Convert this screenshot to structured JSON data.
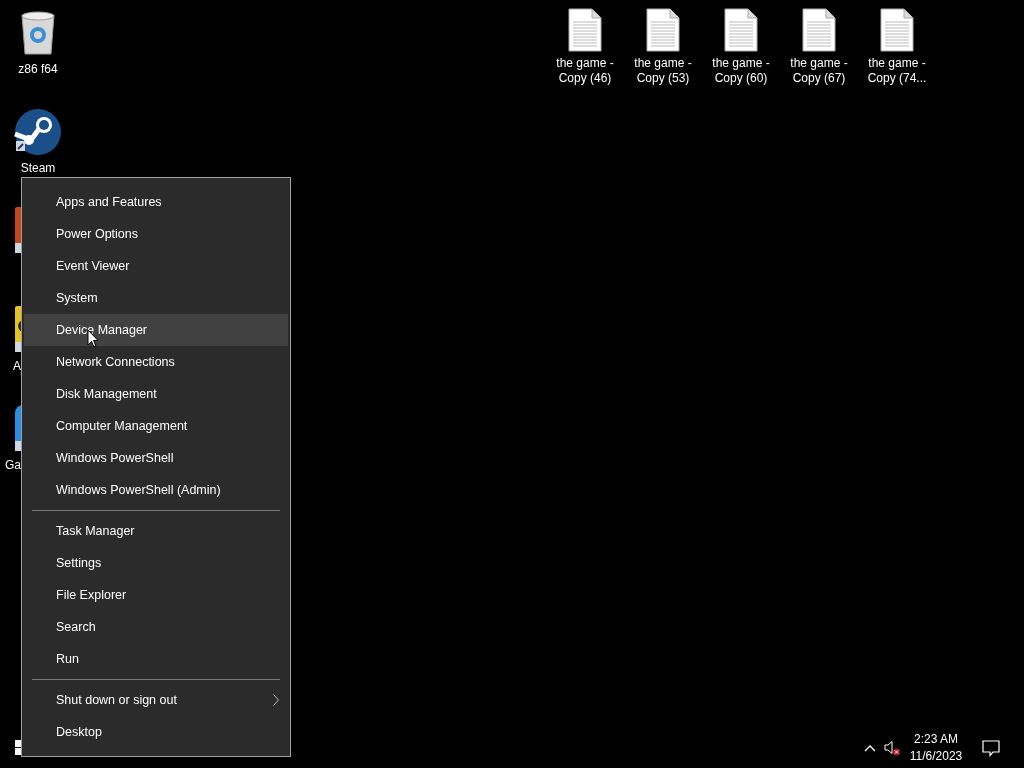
{
  "desktop_icons": [
    {
      "label": "z86 f64",
      "kind": "recycle-bin"
    },
    {
      "label": "Steam",
      "kind": "steam"
    },
    {
      "kind": "orange-app"
    },
    {
      "label": "A",
      "kind": "yellow-app"
    },
    {
      "label": "Ga",
      "kind": "blue-app"
    }
  ],
  "files": [
    {
      "label": "the game - Copy (46)"
    },
    {
      "label": "the game - Copy (53)"
    },
    {
      "label": "the game - Copy (60)"
    },
    {
      "label": "the game - Copy (67)"
    },
    {
      "label": "the game - Copy (74..."
    }
  ],
  "context_menu": {
    "groups": [
      [
        {
          "label": "Apps and Features",
          "selected": false,
          "submenu": false
        },
        {
          "label": "Power Options",
          "selected": false,
          "submenu": false
        },
        {
          "label": "Event Viewer",
          "selected": false,
          "submenu": false
        },
        {
          "label": "System",
          "selected": false,
          "submenu": false
        },
        {
          "label": "Device Manager",
          "selected": true,
          "submenu": false
        },
        {
          "label": "Network Connections",
          "selected": false,
          "submenu": false
        },
        {
          "label": "Disk Management",
          "selected": false,
          "submenu": false
        },
        {
          "label": "Computer Management",
          "selected": false,
          "submenu": false
        },
        {
          "label": "Windows PowerShell",
          "selected": false,
          "submenu": false
        },
        {
          "label": "Windows PowerShell (Admin)",
          "selected": false,
          "submenu": false
        }
      ],
      [
        {
          "label": "Task Manager",
          "selected": false,
          "submenu": false
        },
        {
          "label": "Settings",
          "selected": false,
          "submenu": false
        },
        {
          "label": "File Explorer",
          "selected": false,
          "submenu": false
        },
        {
          "label": "Search",
          "selected": false,
          "submenu": false
        },
        {
          "label": "Run",
          "selected": false,
          "submenu": false
        }
      ],
      [
        {
          "label": "Shut down or sign out",
          "selected": false,
          "submenu": true
        },
        {
          "label": "Desktop",
          "selected": false,
          "submenu": false
        }
      ]
    ]
  },
  "tray": {
    "time": "2:23 AM",
    "date": "11/6/2023",
    "muted": true
  }
}
